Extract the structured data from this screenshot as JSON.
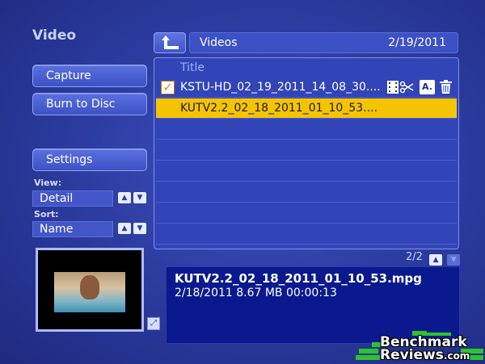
{
  "page": {
    "title": "Video"
  },
  "sidebar": {
    "capture_label": "Capture",
    "burn_label": "Burn to Disc",
    "settings_label": "Settings",
    "view_label": "View:",
    "view_value": "Detail",
    "sort_label": "Sort:",
    "sort_value": "Name"
  },
  "header": {
    "folder": "Videos",
    "date": "2/19/2011"
  },
  "list": {
    "column_title": "Title",
    "items": [
      {
        "title": "KSTU-HD_02_19_2011_14_08_30....",
        "checked": true
      },
      {
        "title": "KUTV2.2_02_18_2011_01_10_53....",
        "checked": false,
        "selected": true
      }
    ],
    "empty_rows": 7
  },
  "pager": {
    "text": "2/2"
  },
  "details": {
    "filename": "KUTV2.2_02_18_2011_01_10_53.mpg",
    "meta": "2/18/2011  8.67 MB  00:00:13"
  },
  "watermark": {
    "line1": "Benchmark",
    "line2": "Reviews",
    "suffix": ".com"
  },
  "icons": {
    "back": "back-arrow-icon",
    "edit": "film-scissors-icon",
    "rename": "text-edit-icon",
    "delete": "trash-icon"
  },
  "colors": {
    "selected_row": "#f5c400",
    "info_panel": "#0a1a8e",
    "accent": "#3245b8"
  }
}
